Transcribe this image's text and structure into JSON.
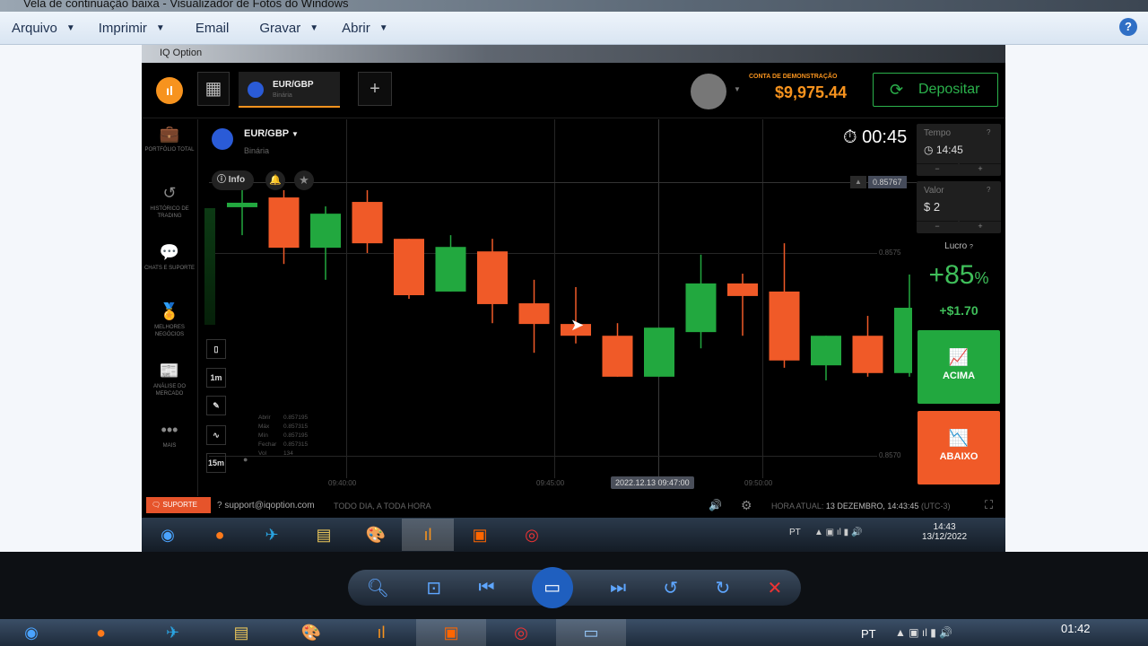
{
  "window": {
    "title": "Vela de continuação baixa - Visualizador de Fotos do Windows"
  },
  "menu": [
    {
      "label": "Arquivo",
      "dropdown": true
    },
    {
      "label": "Imprimir",
      "dropdown": true
    },
    {
      "label": "Email",
      "dropdown": false
    },
    {
      "label": "Gravar",
      "dropdown": true
    },
    {
      "label": "Abrir",
      "dropdown": true
    }
  ],
  "help_icon": "?",
  "iq": {
    "title": "IQ Option",
    "tab": {
      "symbol": "EUR/GBP",
      "type": "Binária"
    },
    "add_tab": "+",
    "account_label": "CONTA DE DEMONSTRAÇÃO",
    "balance": "$9,975.44",
    "deposit_label": "Depositar",
    "sidebar": [
      {
        "icon": "briefcase-icon",
        "glyph": "💼",
        "label": "PORTFÓLIO TOTAL"
      },
      {
        "icon": "history-icon",
        "glyph": "↺",
        "label": "HISTÓRICO DE TRADING"
      },
      {
        "icon": "chat-icon",
        "glyph": "💬",
        "label": "CHATS E SUPORTE"
      },
      {
        "icon": "medal-icon",
        "glyph": "🏅",
        "label": "MELHORES NEGÓCIOS"
      },
      {
        "icon": "news-icon",
        "glyph": "📰",
        "label": "ANÁLISE DO MERCADO"
      },
      {
        "icon": "more-icon",
        "glyph": "•••",
        "label": "MAIS"
      }
    ],
    "asset": {
      "symbol": "EUR/GBP",
      "type": "Binária",
      "info_label": "Info"
    },
    "timer": "00:45",
    "current_price": "0.85767",
    "tools": [
      "1m",
      "15m"
    ],
    "ohlc": [
      {
        "k": "Abrir",
        "v": "0.857195"
      },
      {
        "k": "Máx",
        "v": "0.857315"
      },
      {
        "k": "Mín",
        "v": "0.857195"
      },
      {
        "k": "Fechar",
        "v": "0.857315"
      },
      {
        "k": "Vol",
        "v": "134"
      }
    ],
    "time_panel": {
      "label": "Tempo",
      "value": "14:45",
      "minus": "−",
      "plus": "+"
    },
    "amount_panel": {
      "label": "Valor",
      "value": "$ 2",
      "minus": "−",
      "plus": "+"
    },
    "profit_label": "Lucro",
    "profit_pct": "+85",
    "pct_sign": "%",
    "profit_value": "+$1.70",
    "up_label": "ACIMA",
    "down_label": "ABAIXO",
    "hover_time": "2022.12.13 09:47:00",
    "footer": {
      "support": "SUPORTE",
      "email": "support@iqoption.com",
      "hours": "TODO DIA, A TODA HORA",
      "clock_label": "HORA ATUAL:",
      "clock": "13 DEZEMBRO, 14:43:45",
      "tz": "(UTC-3)"
    },
    "inner_taskbar": {
      "lang": "PT",
      "time": "14:43",
      "date": "13/12/2022"
    }
  },
  "outer_taskbar": {
    "lang": "PT",
    "time": "01:42"
  },
  "colors": {
    "up": "#22a83f",
    "down": "#f05a28",
    "accent": "#f7931e",
    "deposit": "#2bb24c"
  },
  "chart_data": {
    "type": "candlestick",
    "x_ticks": [
      "09:40:00",
      "09:45:00",
      "09:50:00"
    ],
    "y_ticks": [
      "0.8575",
      "0.8570"
    ],
    "ylim": [
      0.857186,
      0.857655
    ],
    "candles": [
      {
        "o": 0.857613,
        "h": 0.857655,
        "l": 0.857544,
        "c": 0.857624
      },
      {
        "o": 0.857637,
        "h": 0.857655,
        "l": 0.857473,
        "c": 0.857513
      },
      {
        "o": 0.857513,
        "h": 0.857615,
        "l": 0.857434,
        "c": 0.857597
      },
      {
        "o": 0.857626,
        "h": 0.857655,
        "l": 0.8575,
        "c": 0.857524
      },
      {
        "o": 0.857535,
        "h": 0.857535,
        "l": 0.857387,
        "c": 0.857396
      },
      {
        "o": 0.857405,
        "h": 0.857544,
        "l": 0.857405,
        "c": 0.857515
      },
      {
        "o": 0.857504,
        "h": 0.857535,
        "l": 0.857327,
        "c": 0.857374
      },
      {
        "o": 0.857376,
        "h": 0.857434,
        "l": 0.857254,
        "c": 0.857325
      },
      {
        "o": 0.857325,
        "h": 0.857416,
        "l": 0.857277,
        "c": 0.857296
      },
      {
        "o": 0.857296,
        "h": 0.857327,
        "l": 0.857195,
        "c": 0.857195
      },
      {
        "o": 0.857195,
        "h": 0.857316,
        "l": 0.857195,
        "c": 0.857316
      },
      {
        "o": 0.857305,
        "h": 0.857496,
        "l": 0.857265,
        "c": 0.857425
      },
      {
        "o": 0.857425,
        "h": 0.857449,
        "l": 0.857296,
        "c": 0.857394
      },
      {
        "o": 0.857405,
        "h": 0.857524,
        "l": 0.857217,
        "c": 0.857235
      },
      {
        "o": 0.857223,
        "h": 0.857296,
        "l": 0.857186,
        "c": 0.857296
      },
      {
        "o": 0.857296,
        "h": 0.857345,
        "l": 0.857195,
        "c": 0.857204
      },
      {
        "o": 0.857204,
        "h": 0.857447,
        "l": 0.857195,
        "c": 0.857365
      }
    ]
  }
}
